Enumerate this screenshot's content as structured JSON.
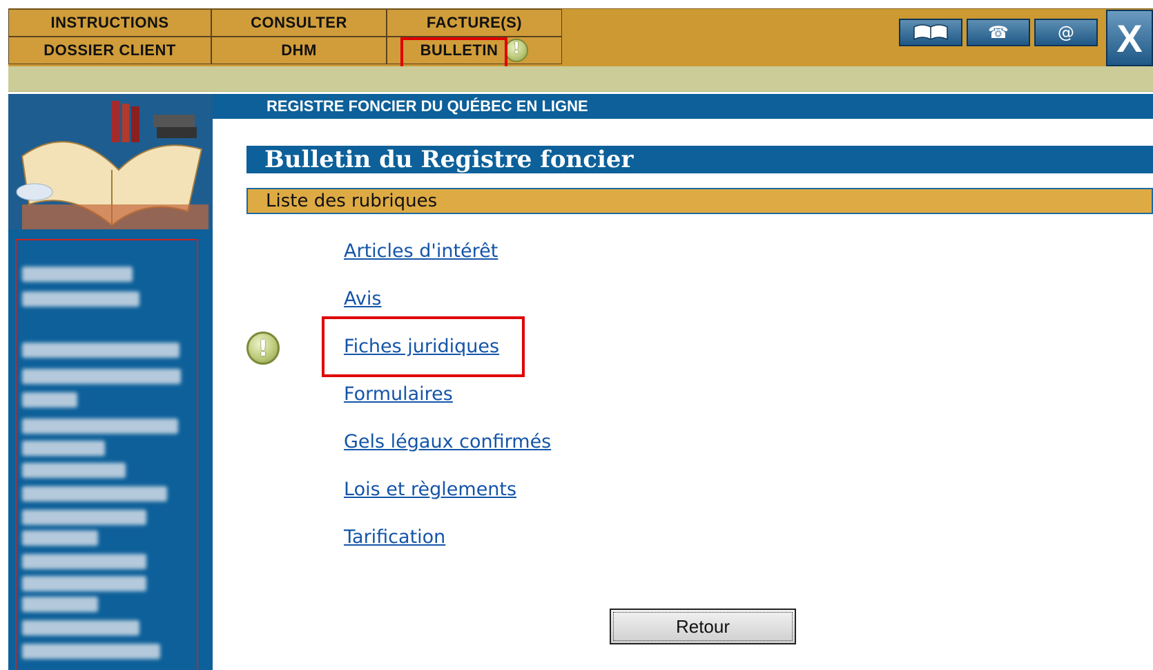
{
  "nav": {
    "row1": [
      "INSTRUCTIONS",
      "CONSULTER",
      "FACTURE(S)"
    ],
    "row2": [
      "DOSSIER CLIENT",
      "DHM",
      "BULLETIN"
    ]
  },
  "toolbar": {
    "icons": [
      "book-icon",
      "phone-icon",
      "email-icon"
    ],
    "close_label": "X"
  },
  "header": {
    "site_title": "REGISTRE FONCIER DU QUÉBEC EN LIGNE"
  },
  "main": {
    "page_title": "Bulletin du Registre foncier",
    "section_title": "Liste des rubriques",
    "rubrics": [
      "Articles d'intérêt",
      "Avis",
      "Fiches juridiques",
      "Formulaires",
      "Gels légaux confirmés",
      "Lois et règlements",
      "Tarification"
    ],
    "back_button": "Retour"
  },
  "colors": {
    "nav_gold": "#CC9933",
    "brand_blue": "#0D6099",
    "section_gold": "#DDAA44",
    "link_blue": "#1455a8",
    "highlight_red": "#e00000"
  }
}
